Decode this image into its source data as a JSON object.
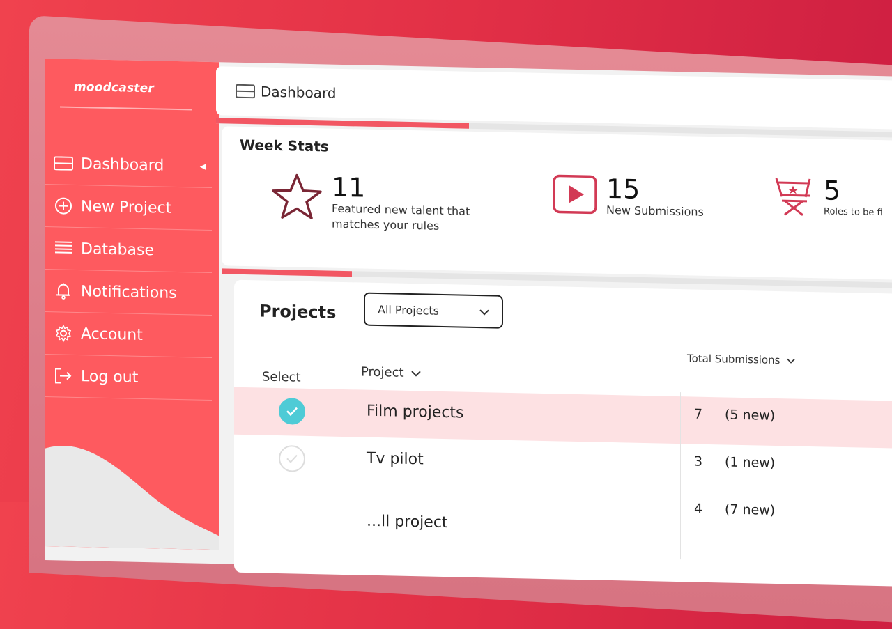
{
  "app": {
    "logo": "moodcaster"
  },
  "sidebar": {
    "items": [
      {
        "label": "Dashboard",
        "icon": "dashboard-icon",
        "active": true
      },
      {
        "label": "New Project",
        "icon": "plus-circle-icon"
      },
      {
        "label": "Database",
        "icon": "list-icon"
      },
      {
        "label": "Notifications",
        "icon": "bell-icon"
      },
      {
        "label": "Account",
        "icon": "gear-icon"
      },
      {
        "label": "Log out",
        "icon": "logout-icon"
      }
    ]
  },
  "header": {
    "title": "Dashboard",
    "icon": "dashboard-icon"
  },
  "progress": {
    "top_fraction": 0.33,
    "mid_fraction": 0.17
  },
  "week_stats": {
    "title": "Week Stats",
    "items": [
      {
        "value": "11",
        "label": "Featured new talent that matches your rules",
        "label_line1": "Featured new talent that",
        "label_line2": "matches your rules",
        "icon": "star-icon"
      },
      {
        "value": "15",
        "label": "New Submissions",
        "icon": "play-icon"
      },
      {
        "value": "5",
        "label": "Roles to be fi",
        "icon": "director-chair-icon"
      }
    ]
  },
  "projects": {
    "title": "Projects",
    "filter": {
      "selected": "All Projects"
    },
    "columns": {
      "select": "Select",
      "project": "Project",
      "total": "Total Submissions"
    },
    "rows": [
      {
        "name": "Film projects",
        "total": "7",
        "new": "(5 new)",
        "selected": true
      },
      {
        "name": "Tv pilot",
        "total": "3",
        "new": "(1 new)",
        "selected": false
      },
      {
        "name": "...ll project",
        "total": "4",
        "new": "(7 new)",
        "selected": false
      }
    ]
  },
  "colors": {
    "brand": "#fe5a5f",
    "check": "#4ecbd6",
    "row_highlight": "#fde1e3",
    "icon_accent": "#d23a55"
  }
}
